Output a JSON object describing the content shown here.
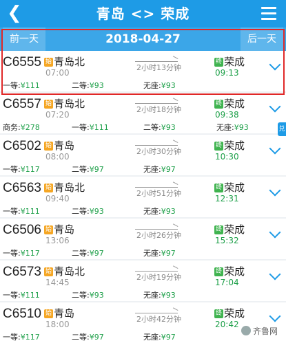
{
  "header": {
    "back_icon": "chevron-left-icon",
    "title": "青岛 <> 荣成",
    "menu_icon": "list-menu-icon"
  },
  "datebar": {
    "prev": "前一天",
    "date": "2018-04-27",
    "next": "后一天"
  },
  "colors": {
    "header": "#1e9be6",
    "datebar": "#3ba6e8",
    "start_badge": "#f5a623",
    "end_badge": "#3fb34f",
    "price": "#1fa04a",
    "highlight": "#e02828"
  },
  "badges": {
    "start": "始",
    "end": "终"
  },
  "side_tag": "兑",
  "trains": [
    {
      "number": "C6555",
      "from": "青岛北",
      "dep": "07:00",
      "duration": "2小时13分钟",
      "to": "荣成",
      "arr": "09:13",
      "prices": [
        {
          "label": "一等:",
          "value": "¥111"
        },
        {
          "label": "二等:",
          "value": "¥93"
        },
        {
          "label": "无座:",
          "value": "¥93"
        }
      ]
    },
    {
      "number": "C6557",
      "from": "青岛北",
      "dep": "07:20",
      "duration": "2小时18分钟",
      "to": "荣成",
      "arr": "09:38",
      "prices": [
        {
          "label": "商务:",
          "value": "¥278"
        },
        {
          "label": "一等:",
          "value": "¥111"
        },
        {
          "label": "二等:",
          "value": "¥93"
        },
        {
          "label": "无座:",
          "value": "¥93"
        }
      ]
    },
    {
      "number": "C6502",
      "from": "青岛",
      "dep": "08:00",
      "duration": "2小时30分钟",
      "to": "荣成",
      "arr": "10:30",
      "prices": [
        {
          "label": "一等:",
          "value": "¥117"
        },
        {
          "label": "二等:",
          "value": "¥97"
        },
        {
          "label": "无座:",
          "value": "¥97"
        }
      ]
    },
    {
      "number": "C6563",
      "from": "青岛北",
      "dep": "09:40",
      "duration": "2小时51分钟",
      "to": "荣成",
      "arr": "12:31",
      "prices": [
        {
          "label": "一等:",
          "value": "¥111"
        },
        {
          "label": "二等:",
          "value": "¥93"
        },
        {
          "label": "无座:",
          "value": "¥93"
        }
      ]
    },
    {
      "number": "C6506",
      "from": "青岛",
      "dep": "13:06",
      "duration": "2小时26分钟",
      "to": "荣成",
      "arr": "15:32",
      "prices": [
        {
          "label": "一等:",
          "value": "¥117"
        },
        {
          "label": "二等:",
          "value": "¥97"
        },
        {
          "label": "无座:",
          "value": "¥97"
        }
      ]
    },
    {
      "number": "C6573",
      "from": "青岛北",
      "dep": "14:45",
      "duration": "2小时19分钟",
      "to": "荣成",
      "arr": "17:04",
      "prices": [
        {
          "label": "一等:",
          "value": "¥111"
        },
        {
          "label": "二等:",
          "value": "¥93"
        },
        {
          "label": "无座:",
          "value": "¥93"
        }
      ]
    },
    {
      "number": "C6510",
      "from": "青岛",
      "dep": "18:00",
      "duration": "2小时42分钟",
      "to": "荣成",
      "arr": "20:42",
      "prices": [
        {
          "label": "一等:",
          "value": "¥117"
        },
        {
          "label": "二等:",
          "value": "¥97"
        },
        {
          "label": "无座:",
          "value": "¥97"
        }
      ]
    }
  ],
  "watermark": "齐鲁网"
}
